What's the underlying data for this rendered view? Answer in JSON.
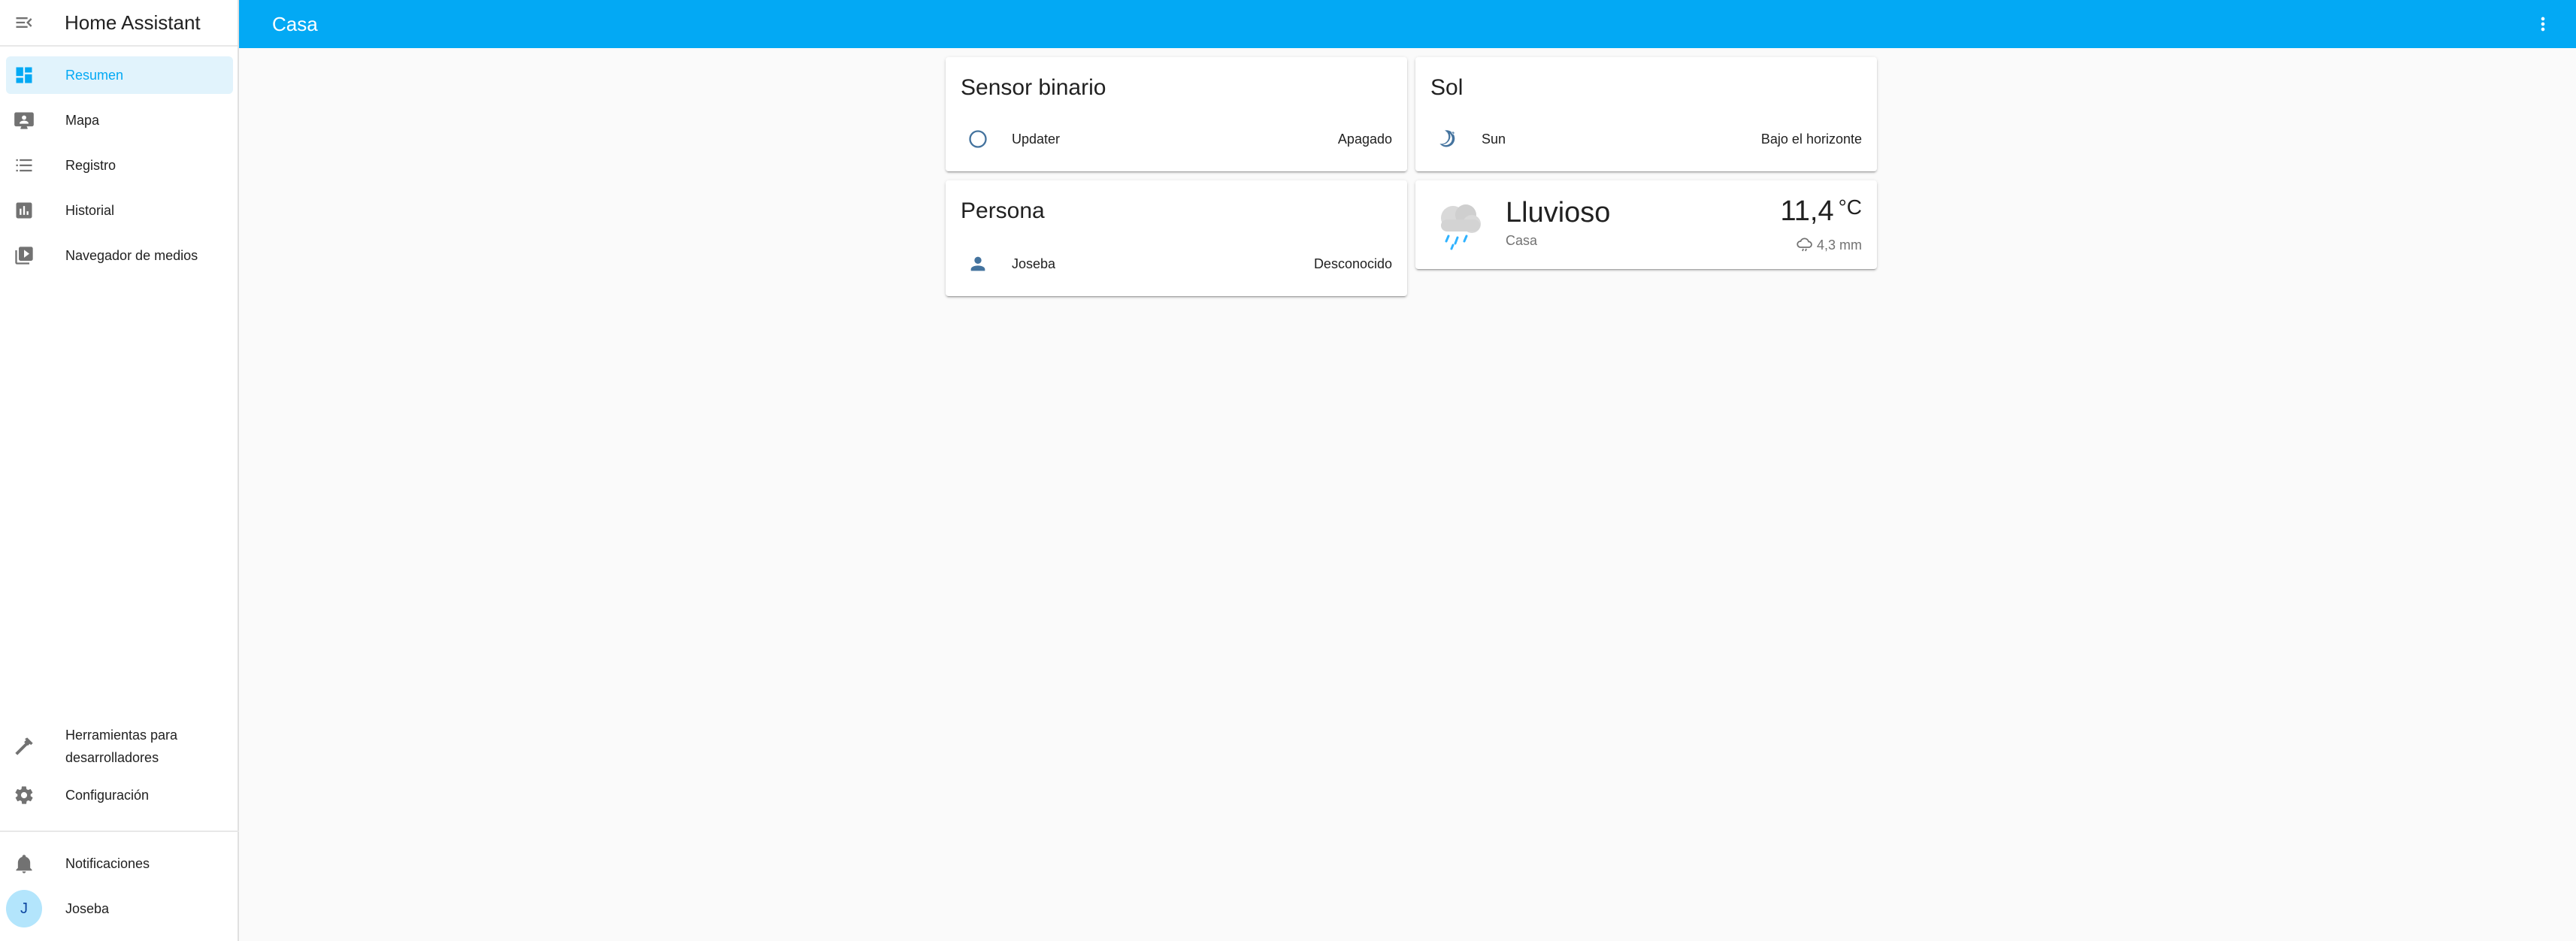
{
  "app": {
    "title": "Home Assistant"
  },
  "topbar": {
    "title": "Casa"
  },
  "sidebar": {
    "items": [
      {
        "label": "Resumen",
        "icon": "dashboard-icon",
        "active": true
      },
      {
        "label": "Mapa",
        "icon": "map-account-icon"
      },
      {
        "label": "Registro",
        "icon": "list-icon"
      },
      {
        "label": "Historial",
        "icon": "chart-box-icon"
      },
      {
        "label": "Navegador de medios",
        "icon": "media-play-icon"
      }
    ],
    "dev_tools": {
      "label": "Herramientas para desarrolladores",
      "icon": "hammer-icon"
    },
    "settings": {
      "label": "Configuración",
      "icon": "gear-icon"
    },
    "notifications": {
      "label": "Notificaciones",
      "icon": "bell-icon"
    },
    "user": {
      "label": "Joseba",
      "avatar_initial": "J"
    }
  },
  "cards": {
    "binary_sensor": {
      "title": "Sensor binario",
      "entities": [
        {
          "name": "Updater",
          "state": "Apagado",
          "icon": "circle-outline-icon"
        }
      ]
    },
    "sun": {
      "title": "Sol",
      "entities": [
        {
          "name": "Sun",
          "state": "Bajo el horizonte",
          "icon": "moon-night-icon"
        }
      ]
    },
    "person": {
      "title": "Persona",
      "entities": [
        {
          "name": "Joseba",
          "state": "Desconocido",
          "icon": "person-icon"
        }
      ]
    },
    "weather": {
      "condition": "Lluvioso",
      "location": "Casa",
      "temperature": "11,4",
      "unit": "°C",
      "precipitation": "4,3 mm",
      "icon": "rainy-cloud-icon"
    }
  },
  "colors": {
    "accent": "#03a9f4",
    "active_bg": "#e1f3fc",
    "icon": "#44739e",
    "sidebar_icon": "#727272"
  }
}
